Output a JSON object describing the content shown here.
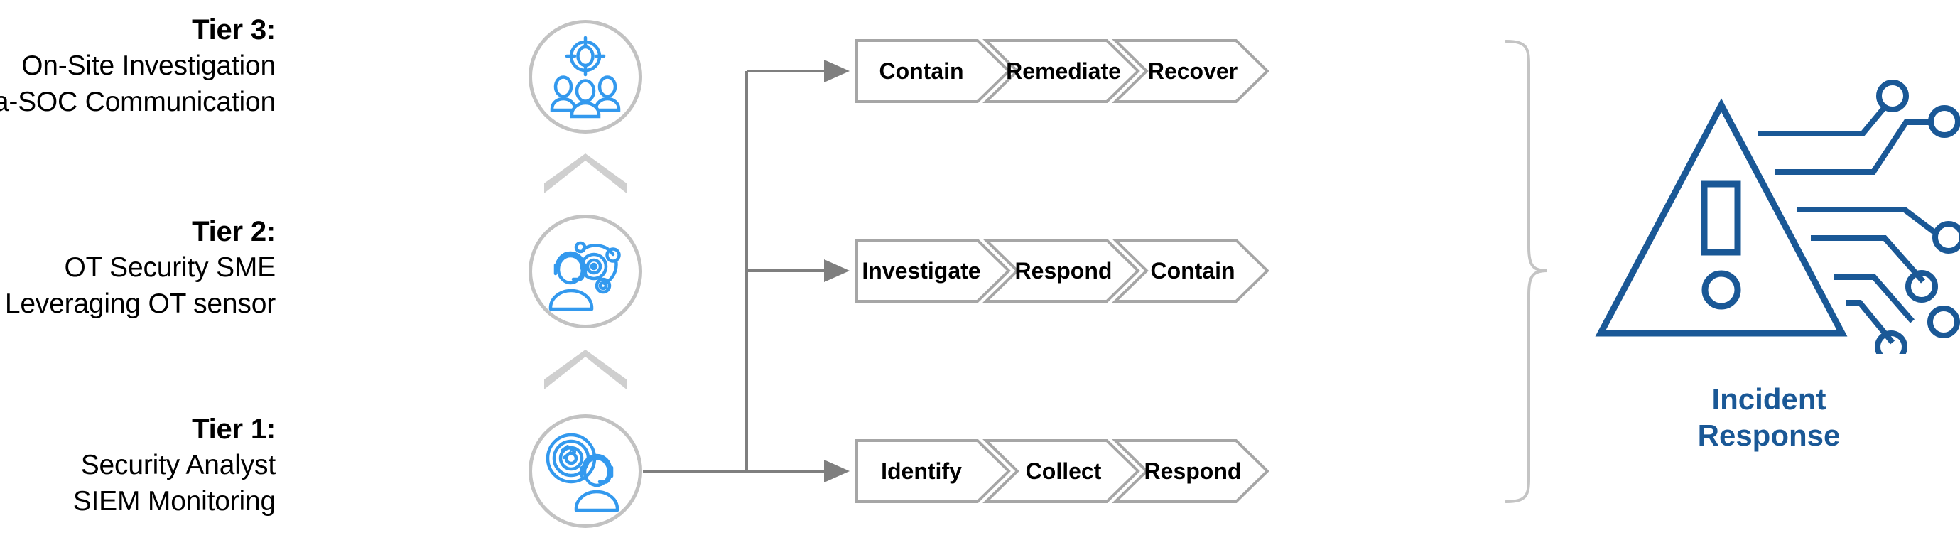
{
  "colors": {
    "icon_blue": "#3399ee",
    "brand_blue": "#1a5896",
    "circle_gray": "#c2c2c2",
    "chevron_gray": "#a6a6a6",
    "connector_gray": "#7f7f7f",
    "escalate_gray": "#cfcfcf",
    "brace_gray": "#c4c4c4",
    "text_black": "#000000",
    "background": "#ffffff"
  },
  "tiers": [
    {
      "title": "Tier 3:",
      "lines": [
        "On-Site Investigation",
        "Intra-SOC Communication"
      ],
      "icon": "target-over-people-icon"
    },
    {
      "title": "Tier 2:",
      "lines": [
        "OT Security SME",
        "Leveraging OT sensor"
      ],
      "icon": "headset-person-sensor-icon"
    },
    {
      "title": "Tier 1:",
      "lines": [
        "Security Analyst",
        "SIEM Monitoring"
      ],
      "icon": "radar-headset-person-icon"
    }
  ],
  "escalation_icons": [
    "escalation-chevron-up-icon",
    "escalation-chevron-up-icon"
  ],
  "process_rows": [
    {
      "name": "tier-3-process",
      "steps": [
        "Contain",
        "Remediate",
        "Recover"
      ]
    },
    {
      "name": "tier-2-process",
      "steps": [
        "Investigate",
        "Respond",
        "Contain"
      ]
    },
    {
      "name": "tier-1-process",
      "steps": [
        "Identify",
        "Collect",
        "Respond"
      ]
    }
  ],
  "connector": {
    "arrowhead_icon": "arrowhead-right-icon",
    "branch_count": 3
  },
  "outcome": {
    "brace_icon": "curly-brace-right-icon",
    "art_icon": "warning-triangle-circuit-icon",
    "title_line_1": "Incident",
    "title_line_2": "Response"
  }
}
